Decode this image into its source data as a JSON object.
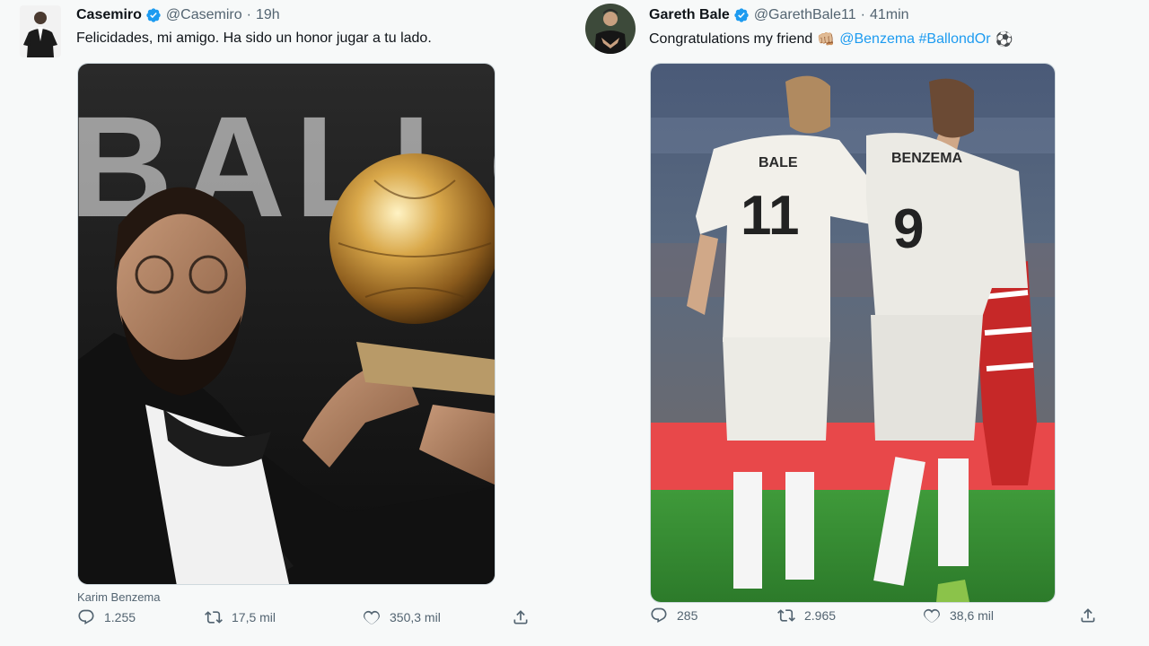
{
  "tweets": [
    {
      "author_name": "Casemiro",
      "handle": "@Casemiro",
      "separator": "·",
      "time": "19h",
      "text": "Felicidades, mi amigo. Ha sido un honor jugar a tu lado.",
      "media_caption": "Karim Benzema",
      "media_description": "Karim Benzema holding the Ballon d'Or trophy",
      "media_wordmark": "BALLON D'OR",
      "replies": "1.255",
      "retweets": "17,5 mil",
      "likes": "350,3 mil"
    },
    {
      "author_name": "Gareth Bale",
      "handle": "@GarethBale11",
      "separator": "·",
      "time": "41min",
      "text": "Congratulations my friend",
      "emoji_1": "👊🏼",
      "mentions": "@Benzema #BallondOr",
      "emoji_2": "⚽",
      "media_description": "Bale and Benzema in white Real Madrid kits on the pitch",
      "shirt_1_name": "BALE",
      "shirt_1_number": "11",
      "shirt_2_name": "BENZEMA",
      "shirt_2_number": "9",
      "replies": "285",
      "retweets": "2.965",
      "likes": "38,6 mil"
    }
  ],
  "icons": [
    "verified-icon",
    "reply-icon",
    "retweet-icon",
    "like-icon",
    "share-icon"
  ],
  "colors": {
    "background": "#f7f9f9",
    "verified": "#1d9bf0",
    "link": "#1d9bf0",
    "secondary_text": "#536471",
    "primary_text": "#0f1419"
  }
}
